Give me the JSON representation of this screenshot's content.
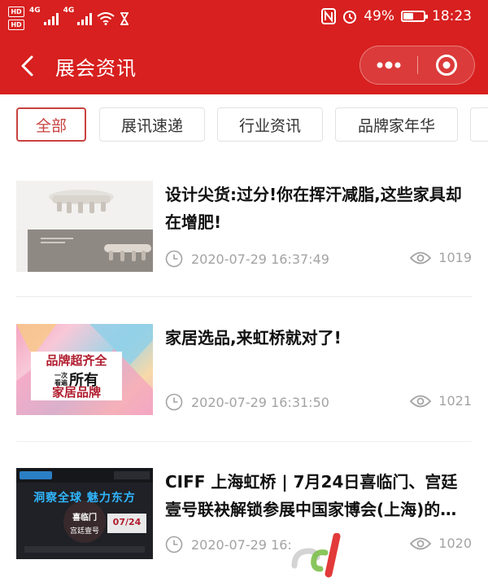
{
  "status_bar": {
    "hd1": "HD",
    "hd2": "HD",
    "net1": "4G",
    "net2": "4G",
    "battery_text": "49%",
    "battery_level": 0.49,
    "time": "18:23"
  },
  "nav": {
    "title": "展会资讯"
  },
  "tabs": [
    {
      "label": "全部",
      "active": true
    },
    {
      "label": "展讯速递",
      "active": false
    },
    {
      "label": "行业资讯",
      "active": false
    },
    {
      "label": "品牌家年华",
      "active": false
    }
  ],
  "articles": [
    {
      "title": "设计尖货:过分!你在挥汗减脂,这些家具却在增肥!",
      "time": "2020-07-29 16:37:49",
      "views": "1019"
    },
    {
      "title": "家居选品,来虹桥就对了!",
      "time": "2020-07-29 16:31:50",
      "views": "1021",
      "thumb_text": {
        "line1": "品牌超齐全",
        "line2a": "一次",
        "line2b": "看遍",
        "line2c": "所有",
        "line3": "家居品牌"
      }
    },
    {
      "title": "CIFF 上海虹桥 | 7月24日喜临门、宫廷壹号联袂解锁参展中国家博会(上海)的…",
      "time": "2020-07-29 16:",
      "views": "1020",
      "thumb_text": {
        "headline": "洞察全球 魅力东方",
        "brand": "喜临门",
        "sub": "宫廷壹号",
        "date": "07/24"
      }
    }
  ],
  "colors": {
    "brand_red": "#d7201f",
    "active_tab": "#c8423f",
    "meta_gray": "#a3a3a3"
  }
}
